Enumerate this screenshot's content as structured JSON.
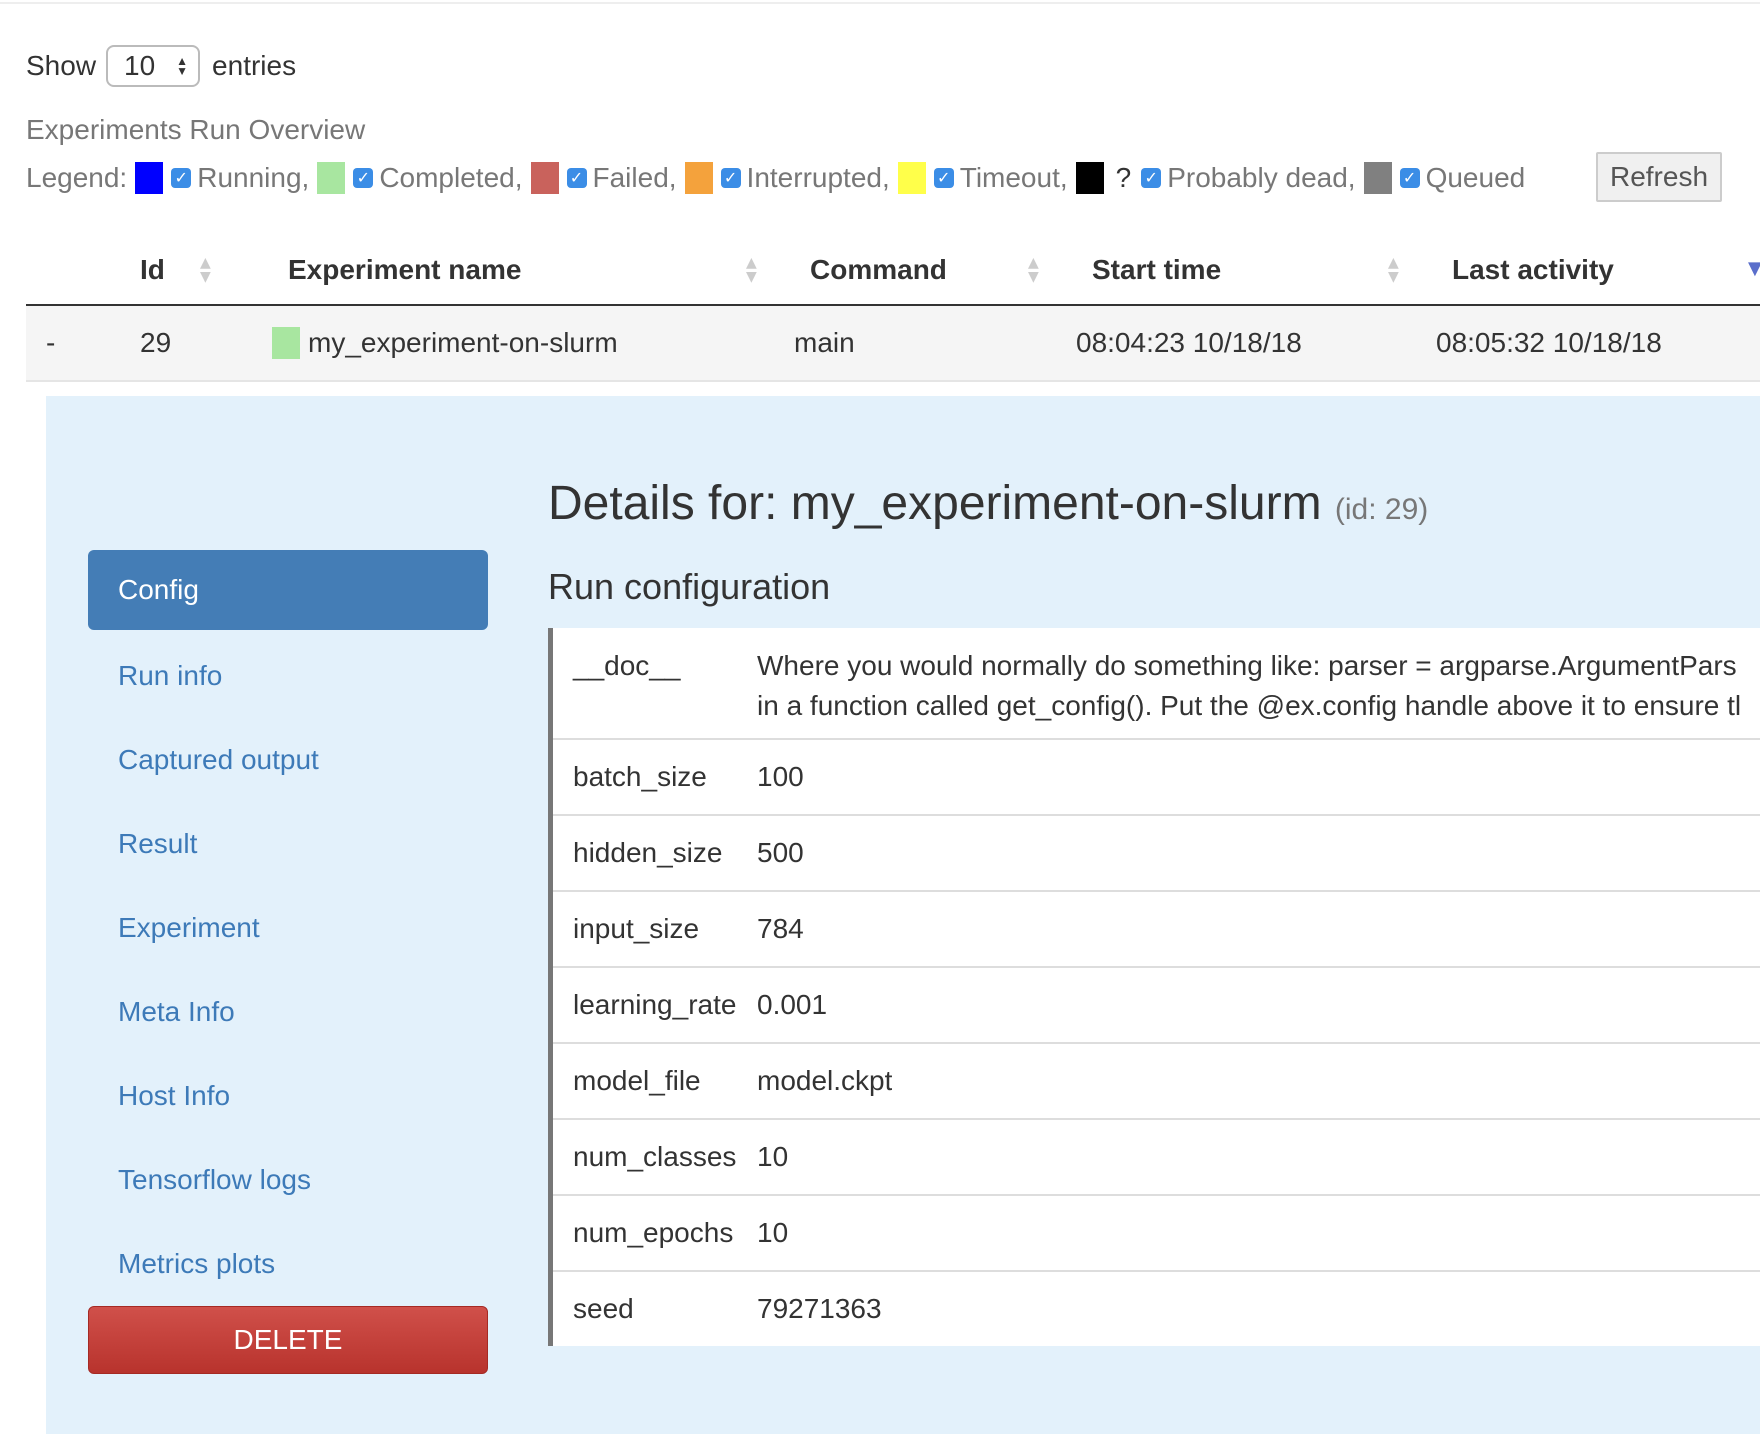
{
  "show_entries": {
    "show_label": "Show",
    "value": "10",
    "entries_label": "entries"
  },
  "overview_title": "Experiments Run Overview",
  "legend": {
    "label": "Legend:",
    "items": [
      {
        "label": "Running,",
        "color": "#0000ff",
        "checked": true
      },
      {
        "label": "Completed,",
        "color": "#a8e6a0",
        "checked": true
      },
      {
        "label": "Failed,",
        "color": "#c9625c",
        "checked": true
      },
      {
        "label": "Interrupted,",
        "color": "#f4a23c",
        "checked": true
      },
      {
        "label": "Timeout,",
        "color": "#ffff4a",
        "checked": true
      },
      {
        "label": "Probably dead,",
        "color": "#000000",
        "prefix": "?",
        "checked": true
      },
      {
        "label": "Queued",
        "color": "#808080",
        "checked": true
      }
    ],
    "refresh_label": "Refresh"
  },
  "table": {
    "columns": [
      "Id",
      "Experiment name",
      "Command",
      "Start time",
      "Last activity"
    ],
    "rows": [
      {
        "toggle": "-",
        "id": "29",
        "name": "my_experiment-on-slurm",
        "status_color": "#a8e6a0",
        "command": "main",
        "start_time": "08:04:23 10/18/18",
        "last_activity": "08:05:32 10/18/18"
      }
    ]
  },
  "details": {
    "title_prefix": "Details for: my_experiment-on-slurm",
    "title_id": "(id: 29)",
    "section_title": "Run configuration",
    "nav": [
      "Config",
      "Run info",
      "Captured output",
      "Result",
      "Experiment",
      "Meta Info",
      "Host Info",
      "Tensorflow logs",
      "Metrics plots"
    ],
    "active_nav": "Config",
    "delete_label": "DELETE",
    "config": {
      "doc_key": "__doc__",
      "doc_line1": "Where you would normally do something like: parser = argparse.ArgumentPars",
      "doc_line2": "in a function called get_config(). Put the @ex.config handle above it to ensure tl",
      "entries": [
        {
          "key": "batch_size",
          "value": "100"
        },
        {
          "key": "hidden_size",
          "value": "500"
        },
        {
          "key": "input_size",
          "value": "784"
        },
        {
          "key": "learning_rate",
          "value": "0.001"
        },
        {
          "key": "model_file",
          "value": "model.ckpt"
        },
        {
          "key": "num_classes",
          "value": "10"
        },
        {
          "key": "num_epochs",
          "value": "10"
        },
        {
          "key": "seed",
          "value": "79271363"
        }
      ]
    }
  }
}
